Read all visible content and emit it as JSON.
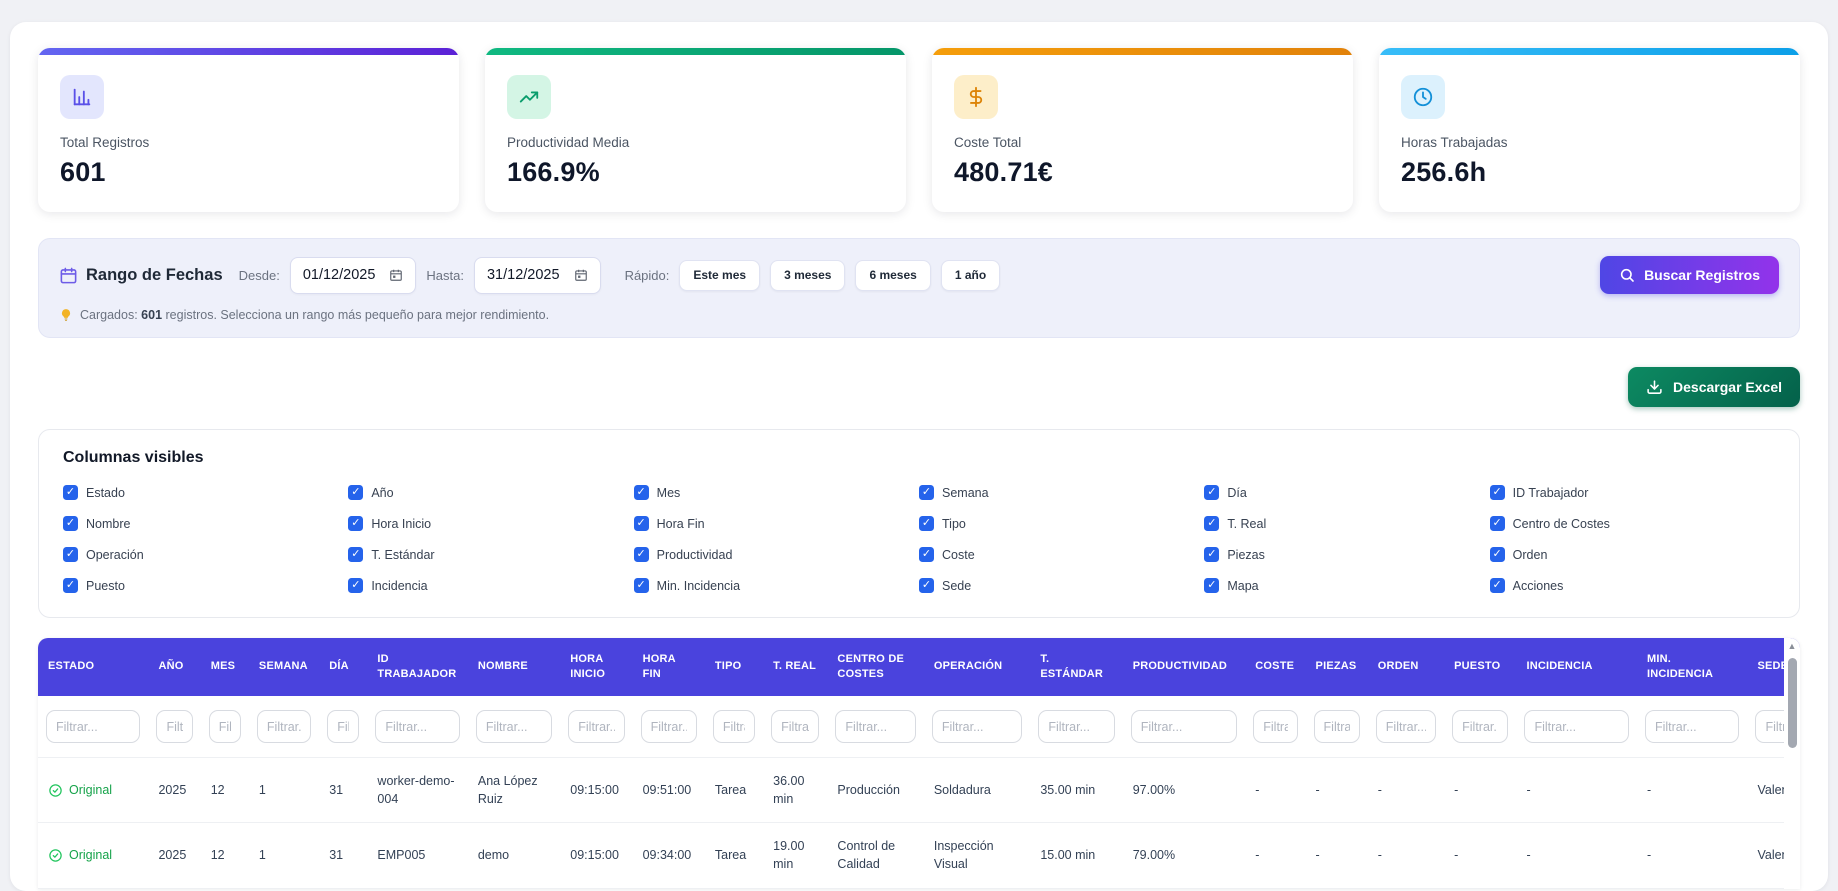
{
  "colors": {
    "page_bg": "#f0f1f5",
    "table_header_bg": "#4a43dd",
    "checkbox_blue": "#2563eb",
    "status_green": "#16a34a",
    "search_button_gradient": [
      "#4f46e5",
      "#9333ea"
    ],
    "excel_button_gradient": [
      "#0d8a62",
      "#04614a"
    ]
  },
  "stats": [
    {
      "label": "Total Registros",
      "value": "601",
      "icon": "bar-chart",
      "bar_from": "#6366f1",
      "bar_to": "#5b21d6",
      "icon_bg": "#e3e6fd",
      "icon_color": "#5a50e8"
    },
    {
      "label": "Productividad Media",
      "value": "166.9%",
      "icon": "trending-up",
      "bar_from": "#10b981",
      "bar_to": "#059669",
      "icon_bg": "#d4f5e5",
      "icon_color": "#0a9d6c"
    },
    {
      "label": "Coste Total",
      "value": "480.71€",
      "icon": "dollar-sign",
      "bar_from": "#f59e0b",
      "bar_to": "#e1820a",
      "icon_bg": "#fdeec9",
      "icon_color": "#dd8407"
    },
    {
      "label": "Horas Trabajadas",
      "value": "256.6h",
      "icon": "clock",
      "bar_from": "#38bdf8",
      "bar_to": "#0c9fe8",
      "icon_bg": "#dcf1fd",
      "icon_color": "#1390d8"
    }
  ],
  "date_range": {
    "title": "Rango de Fechas",
    "from_label": "Desde:",
    "from_value": "01/12/2025",
    "to_label": "Hasta:",
    "to_value": "31/12/2025",
    "quick_label": "Rápido:",
    "quick_options": [
      "Este mes",
      "3 meses",
      "6 meses",
      "1 año"
    ],
    "search_button": "Buscar Registros",
    "info_prefix": "Cargados:",
    "info_count": "601",
    "info_suffix": "registros. Selecciona un rango más pequeño para mejor rendimiento."
  },
  "export_button": "Descargar Excel",
  "columns_panel": {
    "title": "Columnas visibles",
    "items": [
      "Estado",
      "Año",
      "Mes",
      "Semana",
      "Día",
      "ID Trabajador",
      "Nombre",
      "Hora Inicio",
      "Hora Fin",
      "Tipo",
      "T. Real",
      "Centro de Costes",
      "Operación",
      "T. Estándar",
      "Productividad",
      "Coste",
      "Piezas",
      "Orden",
      "Puesto",
      "Incidencia",
      "Min. Incidencia",
      "Sede",
      "Mapa",
      "Acciones"
    ],
    "all_checked": true
  },
  "table": {
    "headers": [
      "ESTADO",
      "AÑO",
      "MES",
      "SEMANA",
      "DÍA",
      "ID TRABAJADOR",
      "NOMBRE",
      "HORA INICIO",
      "HORA FIN",
      "TIPO",
      "T. REAL",
      "CENTRO DE COSTES",
      "OPERACIÓN",
      "T. ESTÁNDAR",
      "PRODUCTIVIDAD",
      "COSTE",
      "PIEZAS",
      "ORDEN",
      "PUESTO",
      "INCIDENCIA",
      "MIN. INCIDENCIA",
      "SEDE"
    ],
    "filter_placeholder": "Filtrar...",
    "status_label": "Original",
    "rows": [
      [
        "Original",
        "2025",
        "12",
        "1",
        "31",
        "worker-demo-004",
        "Ana López Ruiz",
        "09:15:00",
        "09:51:00",
        "Tarea",
        "36.00 min",
        "Producción",
        "Soldadura",
        "35.00 min",
        "97.00%",
        "-",
        "-",
        "-",
        "-",
        "-",
        "-",
        "Valencia"
      ],
      [
        "Original",
        "2025",
        "12",
        "1",
        "31",
        "EMP005",
        "demo",
        "09:15:00",
        "09:34:00",
        "Tarea",
        "19.00 min",
        "Control de Calidad",
        "Inspección Visual",
        "15.00 min",
        "79.00%",
        "-",
        "-",
        "-",
        "-",
        "-",
        "-",
        "Valencia"
      ]
    ]
  }
}
